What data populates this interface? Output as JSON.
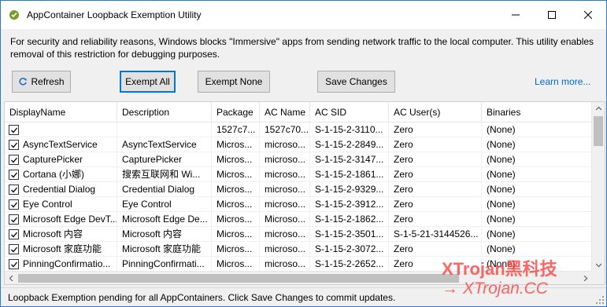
{
  "window": {
    "title": "AppContainer Loopback Exemption Utility",
    "description": "For security and reliability reasons, Windows blocks \"Immersive\" apps from sending network traffic to the local computer. This utility enables removal of this restriction for debugging purposes."
  },
  "toolbar": {
    "refresh_label": "Refresh",
    "exempt_all_label": "Exempt All",
    "exempt_none_label": "Exempt None",
    "save_changes_label": "Save Changes",
    "learn_more_label": "Learn more..."
  },
  "table": {
    "columns": [
      "DisplayName",
      "Description",
      "Package",
      "AC Name",
      "AC SID",
      "AC User(s)",
      "Binaries"
    ],
    "rows": [
      [
        "",
        "",
        "1527c7...",
        "1527c70...",
        "S-1-15-2-3110...",
        "Zero",
        "(None)"
      ],
      [
        "AsyncTextService",
        "AsyncTextService",
        "Micros...",
        "microso...",
        "S-1-15-2-2849...",
        "Zero",
        "(None)"
      ],
      [
        "CapturePicker",
        "CapturePicker",
        "Micros...",
        "microso...",
        "S-1-15-2-3147...",
        "Zero",
        "(None)"
      ],
      [
        "Cortana (小娜)",
        "搜索互联网和 Wi...",
        "Micros...",
        "microso...",
        "S-1-15-2-1861...",
        "Zero",
        "(None)"
      ],
      [
        "Credential Dialog",
        "Credential Dialog",
        "Micros...",
        "microso...",
        "S-1-15-2-9329...",
        "Zero",
        "(None)"
      ],
      [
        "Eye Control",
        "Eye Control",
        "Micros...",
        "microso...",
        "S-1-15-2-3912...",
        "Zero",
        "(None)"
      ],
      [
        "Microsoft Edge DevT...",
        "Microsoft Edge De...",
        "Micros...",
        "Microso...",
        "S-1-15-2-1862...",
        "Zero",
        "(None)"
      ],
      [
        "Microsoft 内容",
        "Microsoft 内容",
        "Micros...",
        "microso...",
        "S-1-15-2-3501...",
        "S-1-5-21-3144526...",
        "(None)"
      ],
      [
        "Microsoft 家庭功能",
        "Microsoft 家庭功能",
        "Micros...",
        "microso...",
        "S-1-15-2-3072...",
        "Zero",
        "(None)"
      ],
      [
        "PinningConfirmatio...",
        "PinningConfirmati...",
        "Micros...",
        "microso...",
        "S-1-15-2-2652...",
        "Zero",
        "(None)"
      ]
    ],
    "checked": [
      true,
      true,
      true,
      true,
      true,
      true,
      true,
      true,
      true,
      true
    ]
  },
  "status": {
    "text": "Loopback Exemption pending for all AppContainers. Click Save Changes to commit updates."
  },
  "watermark": {
    "line1": "XTrojan黑科技",
    "line2": "→ XTrojan.CC"
  },
  "colors": {
    "accent": "#0078d7",
    "link": "#0066cc",
    "watermark": "#ff3b3b"
  },
  "icons": [
    "app-icon",
    "minimize-icon",
    "maximize-icon",
    "close-icon",
    "refresh-icon",
    "checkbox-checked-icon"
  ]
}
